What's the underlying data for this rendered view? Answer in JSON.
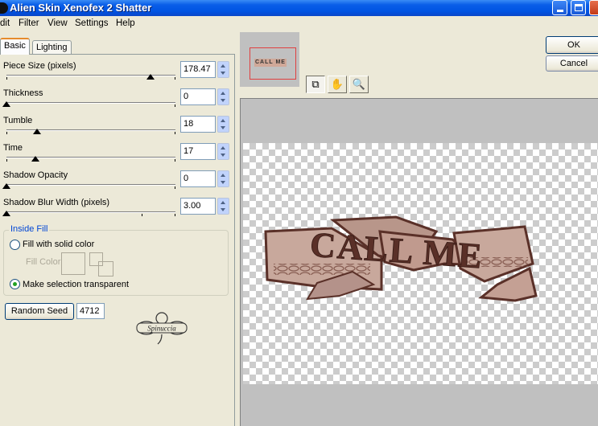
{
  "window": {
    "title": "Alien Skin Xenofex 2 Shatter"
  },
  "menu": [
    "dit",
    "Filter",
    "View",
    "Settings",
    "Help"
  ],
  "tabs": [
    {
      "label": "Basic",
      "active": true
    },
    {
      "label": "Lighting",
      "active": false
    }
  ],
  "params": [
    {
      "label": "Piece Size (pixels)",
      "value": "178.47",
      "level": 0.85
    },
    {
      "label": "Thickness",
      "value": "0",
      "level": 0.0
    },
    {
      "label": "Tumble",
      "value": "18",
      "level": 0.18
    },
    {
      "label": "Time",
      "value": "17",
      "level": 0.17
    },
    {
      "label": "Shadow Opacity",
      "value": "0",
      "level": 0.0
    },
    {
      "label": "Shadow Blur Width (pixels)",
      "value": "3.00",
      "level": 0.0
    }
  ],
  "inside_fill": {
    "legend": "Inside Fill",
    "option_solid": "Fill with solid color",
    "fill_color_label": "Fill Color",
    "option_transparent": "Make selection transparent",
    "selected": "transparent"
  },
  "seed": {
    "button_label": "Random Seed",
    "value": "4712"
  },
  "watermark": {
    "text": "Spinuccia"
  },
  "buttons": {
    "ok": "OK",
    "cancel": "Cancel"
  },
  "thumbnail": {
    "text": "CALL ME"
  },
  "preview": {
    "text": "CALL ME"
  },
  "colors": {
    "title_bar": "#0054e3",
    "panel": "#ece9d8",
    "accent_tab": "#e68b2c",
    "fill_legend": "#0046d5",
    "artwork": "#b8968a"
  }
}
